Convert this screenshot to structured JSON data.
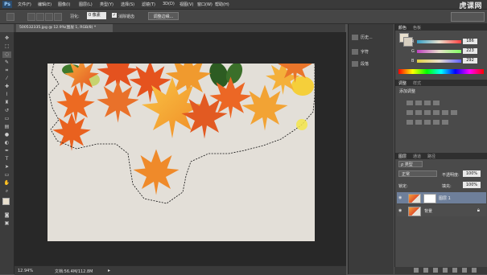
{
  "app": {
    "logo": "Ps",
    "brand": "虎课网"
  },
  "menu": [
    "文件(F)",
    "编辑(E)",
    "图像(I)",
    "图层(L)",
    "类型(Y)",
    "选择(S)",
    "滤镜(T)",
    "3D(D)",
    "视图(V)",
    "窗口(W)",
    "帮助(H)"
  ],
  "options": {
    "feather_label": "羽化:",
    "feather_value": "0 像素",
    "antialias_label": "消除锯齿",
    "antialias_checked": "✓",
    "refine_edge": "调整边缘..."
  },
  "document": {
    "tab": "500532335.jpg @ 12.9%(图层 1, RGB/8) *",
    "zoom": "12.94%",
    "doc_size": "文档:56.4M/112.8M"
  },
  "mid_panel": {
    "history": "历史...",
    "character": "字符",
    "paragraph": "段落"
  },
  "color_panel": {
    "tabs": [
      "颜色",
      "色板"
    ],
    "fg_color": "#e9e0ce",
    "sliders": [
      {
        "label": "R",
        "value": "186"
      },
      {
        "label": "G",
        "value": "223"
      },
      {
        "label": "B",
        "value": "292"
      }
    ]
  },
  "adjustments_panel": {
    "tabs": [
      "调整",
      "样式"
    ],
    "add_label": "添加调整"
  },
  "layers_panel": {
    "tabs": [
      "图层",
      "通道",
      "路径"
    ],
    "kind": "ρ 类型",
    "blend_mode": "正常",
    "opacity_label": "不透明度:",
    "opacity_value": "100%",
    "lock_label": "锁定:",
    "fill_label": "填充:",
    "fill_value": "100%",
    "layers": [
      {
        "name": "图层 1",
        "selected": true
      },
      {
        "name": "背景",
        "locked": true
      }
    ]
  }
}
